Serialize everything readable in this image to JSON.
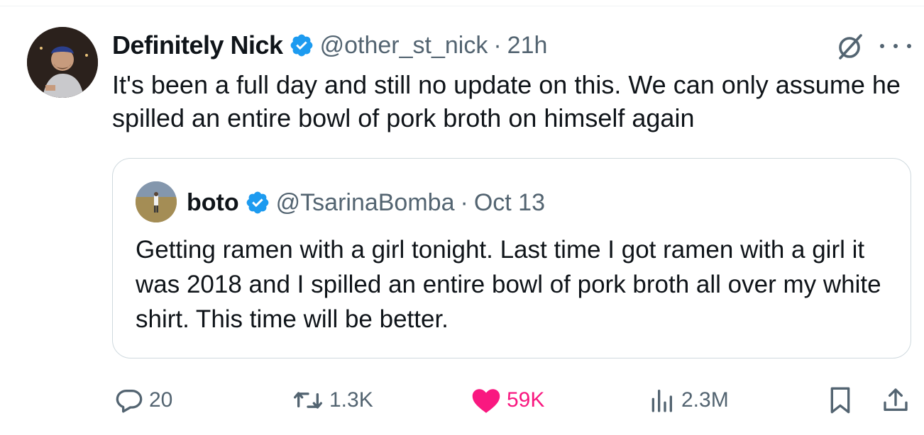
{
  "tweet": {
    "display_name": "Definitely Nick",
    "handle": "@other_st_nick",
    "separator": "·",
    "time": "21h",
    "text": "It's been a full day and still no update on this. We can only assume he spilled an entire bowl of pork broth on himself again",
    "verified": true
  },
  "quote": {
    "display_name": "boto",
    "handle": "@TsarinaBomba",
    "separator": "·",
    "date": "Oct 13",
    "text": "Getting ramen with a girl tonight. Last time I got ramen with a girl it was 2018 and I spilled an entire bowl of pork broth all over my white shirt. This time will be better.",
    "verified": true
  },
  "actions": {
    "replies": "20",
    "reposts": "1.3K",
    "likes": "59K",
    "views": "2.3M",
    "liked": true
  },
  "colors": {
    "text_primary": "#0f1419",
    "text_secondary": "#536471",
    "verified_blue": "#1d9bf0",
    "like_pink": "#f91880",
    "border": "#cfd9de"
  },
  "icons": {
    "verified": "verified-badge-icon",
    "grok": "grok-icon",
    "more": "more-dots-icon",
    "reply": "reply-bubble-icon",
    "repost": "repost-arrows-icon",
    "like": "heart-filled-icon",
    "views": "bar-chart-icon",
    "bookmark": "bookmark-icon",
    "share": "share-upload-icon"
  }
}
